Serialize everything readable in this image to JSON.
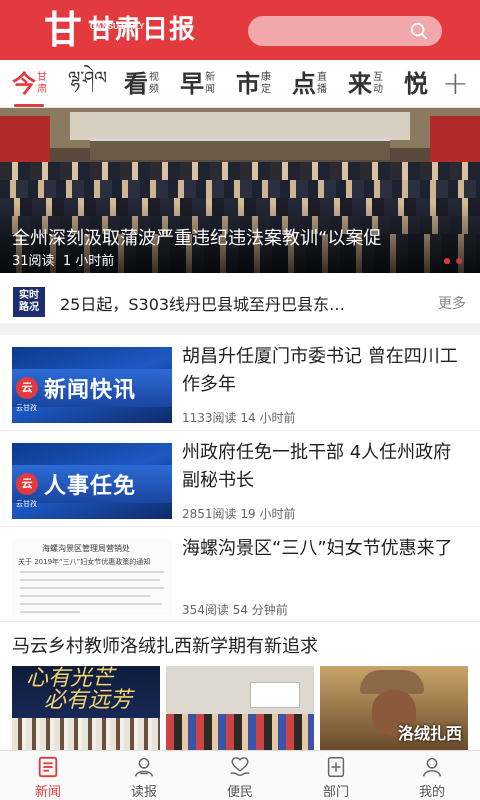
{
  "header": {
    "logo_mark": "甘",
    "logo_text": "甘肃日报",
    "logo_sub": "GANSU DAILY",
    "brand_color": "#e23a3e"
  },
  "tabs": [
    {
      "big": "今",
      "small": [
        "甘",
        "肃"
      ],
      "active": true
    },
    {
      "tibetan": "ལྷ་ཤེལ"
    },
    {
      "big": "看",
      "small": [
        "视",
        "频"
      ]
    },
    {
      "big": "早",
      "small": [
        "新",
        "闻"
      ]
    },
    {
      "big": "市",
      "small": [
        "康",
        "定"
      ]
    },
    {
      "big": "点",
      "small": [
        "直",
        "播"
      ]
    },
    {
      "big": "来",
      "small": [
        "互",
        "动"
      ]
    },
    {
      "big": "悦",
      "small": []
    }
  ],
  "hero": {
    "title": "全州深刻汲取蒲波严重违纪违法案教训“以案促",
    "reads": "31阅读",
    "time": "1 小时前"
  },
  "live": {
    "badge_line1": "实时",
    "badge_line2": "路况",
    "text": "25日起，S303线丹巴县城至丹巴县东…",
    "more": "更多"
  },
  "news": [
    {
      "title": "胡昌升任厦门市委书记 曾在四川工作多年",
      "meta": "1133阅读  14 小时前",
      "thumb_text": "新闻快讯",
      "thumb_logo": "云",
      "thumb_caption": "云甘孜"
    },
    {
      "title": "州政府任免一批干部 4人任州政府副秘书长",
      "meta": "2851阅读  19 小时前",
      "thumb_text": "人事任免",
      "thumb_logo": "云",
      "thumb_caption": "云甘孜"
    },
    {
      "title": "海螺沟景区“三八”妇女节优惠来了",
      "meta": "354阅读  54 分钟前",
      "doc_head": "海螺沟景区管理局营销处",
      "doc_sub": "关于 2019年“三八”妇女节优惠政策的通知"
    }
  ],
  "feature": {
    "title": "马云乡村教师洛绒扎西新学期有新追求",
    "img1_line1": "心有光芒",
    "img1_line2": "必有远芳",
    "img3_name": "洛绒扎西"
  },
  "bottom_nav": [
    {
      "label": "新闻",
      "icon": "news-icon",
      "active": true
    },
    {
      "label": "读报",
      "icon": "read-paper-icon"
    },
    {
      "label": "便民",
      "icon": "service-icon"
    },
    {
      "label": "部门",
      "icon": "department-icon"
    },
    {
      "label": "我的",
      "icon": "profile-icon"
    }
  ]
}
